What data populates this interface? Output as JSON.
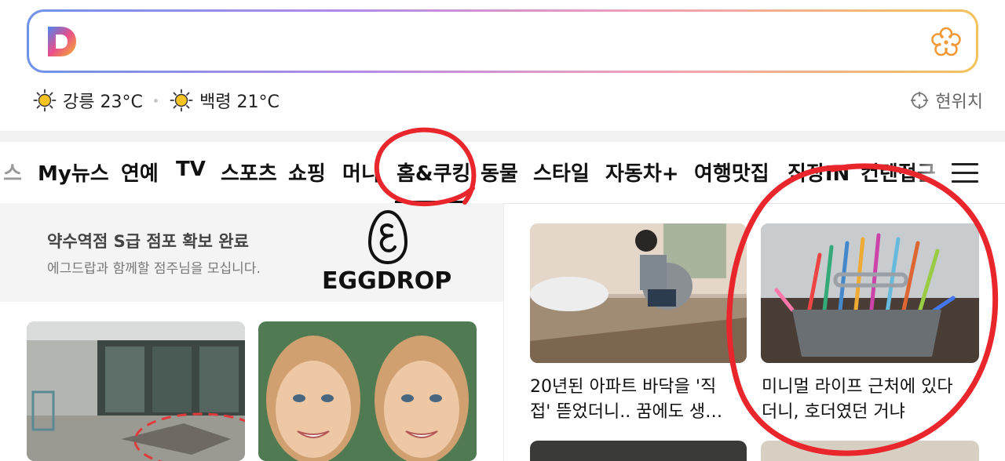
{
  "search": {
    "logo_letter": "D",
    "placeholder": ""
  },
  "weather": [
    {
      "city_temp": "강릉 23°C",
      "icon": "sun-icon"
    },
    {
      "city_temp": "백령 21°C",
      "icon": "sun-icon"
    }
  ],
  "location_label": "현위치",
  "nav": {
    "items": [
      "스",
      "My뉴스",
      "연예",
      "TV",
      "스포츠",
      "쇼핑",
      "머니",
      "홈&쿠킹",
      "동물",
      "스타일",
      "자동차+",
      "여행맛집",
      "직장IN",
      "컨텐접근"
    ],
    "active": "홈&쿠킹"
  },
  "ad": {
    "title": "약수역점 S급 점포 확보 완료",
    "description": "에그드랍과 함께할 점주님을 모십니다.",
    "brand": "EGGDROP"
  },
  "articles": [
    {
      "caption_line1": "20년된 아파트 바닥을 '직",
      "caption_line2": "접' 뜯었더니.. 꿈에도 생…"
    },
    {
      "caption_line1": "미니멀 라이프 근처에 있다",
      "caption_line2": "더니, 호더였던 거냐"
    }
  ],
  "colors": {
    "annotation_red": "#e8262c",
    "nav_text": "#111111",
    "ad_bg": "#f4f4f4"
  }
}
